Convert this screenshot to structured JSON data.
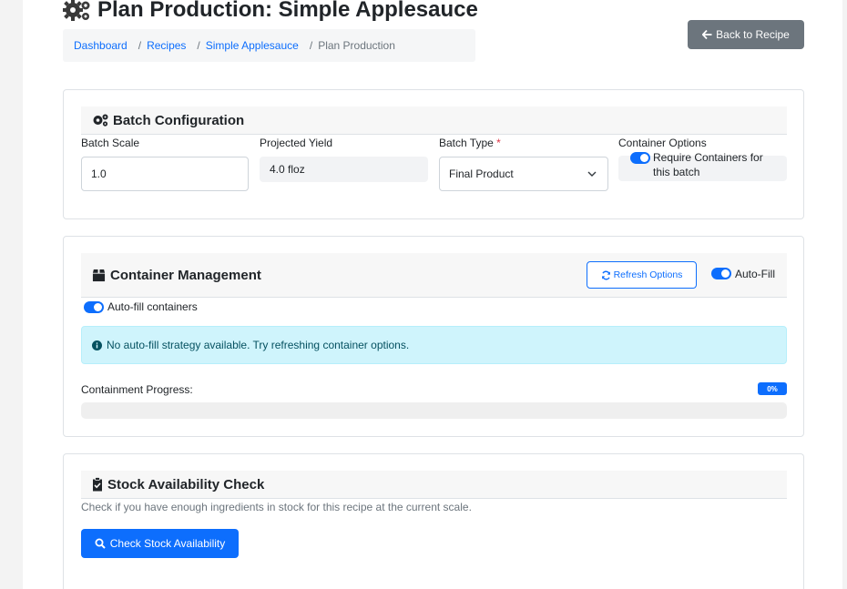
{
  "page": {
    "title": "Plan Production: Simple Applesauce",
    "title_icon": "gears-icon"
  },
  "breadcrumb": {
    "items": [
      "Dashboard",
      "Recipes",
      "Simple Applesauce"
    ],
    "active": "Plan Production",
    "separator": "/"
  },
  "back_button": {
    "label": "Back to Recipe",
    "icon": "arrow-left-icon"
  },
  "batch_config": {
    "title": "Batch Configuration",
    "icon": "gears-icon",
    "batch_scale": {
      "label": "Batch Scale",
      "value": "1.0"
    },
    "projected_yield": {
      "label": "Projected Yield",
      "value": "4.0 floz"
    },
    "batch_type": {
      "label": "Batch Type",
      "required_mark": "*",
      "selected": "Final Product"
    },
    "container_options": {
      "label": "Container Options",
      "toggle_label": "Require Containers for this batch",
      "enabled": true
    }
  },
  "container_mgmt": {
    "title": "Container Management",
    "icon": "box-icon",
    "refresh_label": "Refresh Options",
    "autofill_toggle_label": "Auto-Fill",
    "autofill_containers_label": "Auto-fill containers",
    "info_message": "No auto-fill strategy available. Try refreshing container options.",
    "progress_label": "Containment Progress:",
    "progress_text": "0%",
    "progress_value": 0
  },
  "stock_check": {
    "title": "Stock Availability Check",
    "icon": "clipboard-check-icon",
    "description": "Check if you have enough ingredients in stock for this recipe at the current scale.",
    "button_label": "Check Stock Availability"
  },
  "colors": {
    "primary": "#0d6efd",
    "secondary": "#6c757d",
    "info_bg": "#cff4fc",
    "danger": "#dc3545"
  }
}
